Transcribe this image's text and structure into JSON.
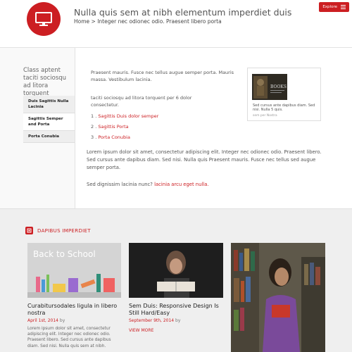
{
  "header": {
    "site_title": "Nulla quis sem at nibh elementum imperdiet duis",
    "breadcrumb": "Home > Integer nec odionec odio. Praesent libero porta",
    "explore_label": "Explore",
    "brand_color": "#cc1e22"
  },
  "sidebar": {
    "heading": "Class aptent taciti sociosqu ad litora torquent",
    "items": [
      {
        "label": "Duis Sagittis Nulla Lacinia"
      },
      {
        "label": "Sagittis Semper and Porta"
      },
      {
        "label": "Porta Conubia"
      }
    ]
  },
  "main": {
    "para1": "Praesent mauris. Fusce nec tellus augue semper porta. Mauris massa. Vestibulum lacinia.",
    "para2": "taciti sociosqu ad litora torquent per 6 dolor consectetur.",
    "list": [
      {
        "num": "1 . ",
        "link": "Sagittis Duis dolor semper"
      },
      {
        "num": "2 . ",
        "link": "Sagittis Porta"
      },
      {
        "num": "3 . ",
        "link": "Porta Conubia"
      }
    ],
    "para3": "Lorem ipsum dolor sit amet, consectetur adipiscing elit. Integer nec odionec odio. Praesent libero. Sed cursus ante dapibus diam. Sed nisi. Nulla quis Praesent mauris. Fusce nec tellus sed augue semper porta.",
    "para4_text": "Sed dignissim lacinia nunc? ",
    "para4_link": "lacinia arcu eget nulla."
  },
  "widget": {
    "image_text": "BOOKS",
    "caption": "Sed cursus ante dapibus diam. Sed nisi. Nulla 5 quis.",
    "credit": "sem per Nostra"
  },
  "section": {
    "title": "DAPIBUS IMPERDIET",
    "cards": [
      {
        "image_text": "Back to School",
        "title": "Curabitursodales ligula in libero nostra",
        "date": "April 1st, 2014",
        "by": " by",
        "text": "Lorem ipsum dolor sit amet, consectetur adipiscing elit. Integer nec odionec odio. Praesent libero. Sed cursus ante dapibus diam. Sed nisi. Nulla quis sem at nibh."
      },
      {
        "title": "Sem Duis: Responsive Design Is Still Hard/Easy",
        "date": "September 9th, 2014",
        "by": " by",
        "view_more": "VIEW MORE"
      }
    ]
  }
}
